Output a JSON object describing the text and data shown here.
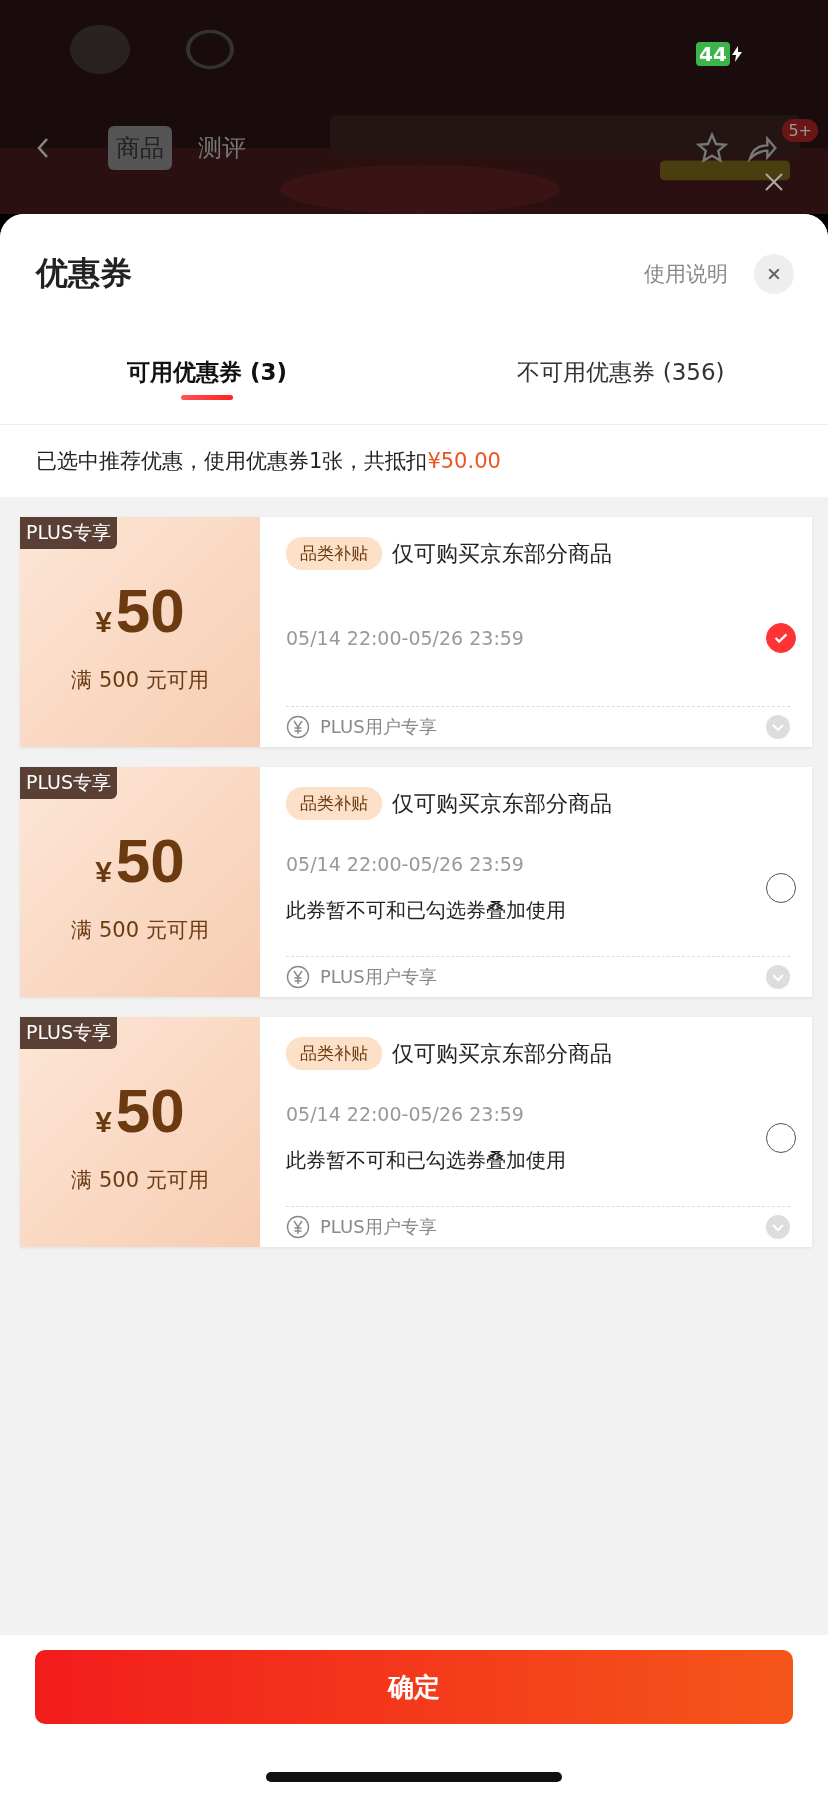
{
  "status_bar": {
    "battery": "44"
  },
  "background": {
    "tabs": [
      {
        "label": "商品",
        "selected": true
      },
      {
        "label": "测评",
        "selected": false
      }
    ],
    "badge": "5+"
  },
  "sheet": {
    "title": "优惠券",
    "help_link": "使用说明",
    "tabs": [
      {
        "label": "可用优惠券 (3)",
        "selected": true
      },
      {
        "label": "不可用优惠券 (356)",
        "selected": false
      }
    ],
    "summary": {
      "text": "已选中推荐优惠，使用优惠券1张，共抵扣",
      "amount": "¥50.00"
    },
    "coupons": [
      {
        "tag": "PLUS专享",
        "currency": "¥",
        "value": "50",
        "condition": "满 500 元可用",
        "category": "品类补贴",
        "scope": "仅可购买京东部分商品",
        "validity": "05/14 22:00-05/26 23:59",
        "selected": true,
        "footer": "PLUS用户专享"
      },
      {
        "tag": "PLUS专享",
        "currency": "¥",
        "value": "50",
        "condition": "满 500 元可用",
        "category": "品类补贴",
        "scope": "仅可购买京东部分商品",
        "validity": "05/14 22:00-05/26 23:59",
        "selected": false,
        "note": "此券暂不可和已勾选券叠加使用",
        "footer": "PLUS用户专享"
      },
      {
        "tag": "PLUS专享",
        "currency": "¥",
        "value": "50",
        "condition": "满 500 元可用",
        "category": "品类补贴",
        "scope": "仅可购买京东部分商品",
        "validity": "05/14 22:00-05/26 23:59",
        "selected": false,
        "note": "此券暂不可和已勾选券叠加使用",
        "footer": "PLUS用户专享"
      }
    ],
    "confirm_button": "确定"
  }
}
